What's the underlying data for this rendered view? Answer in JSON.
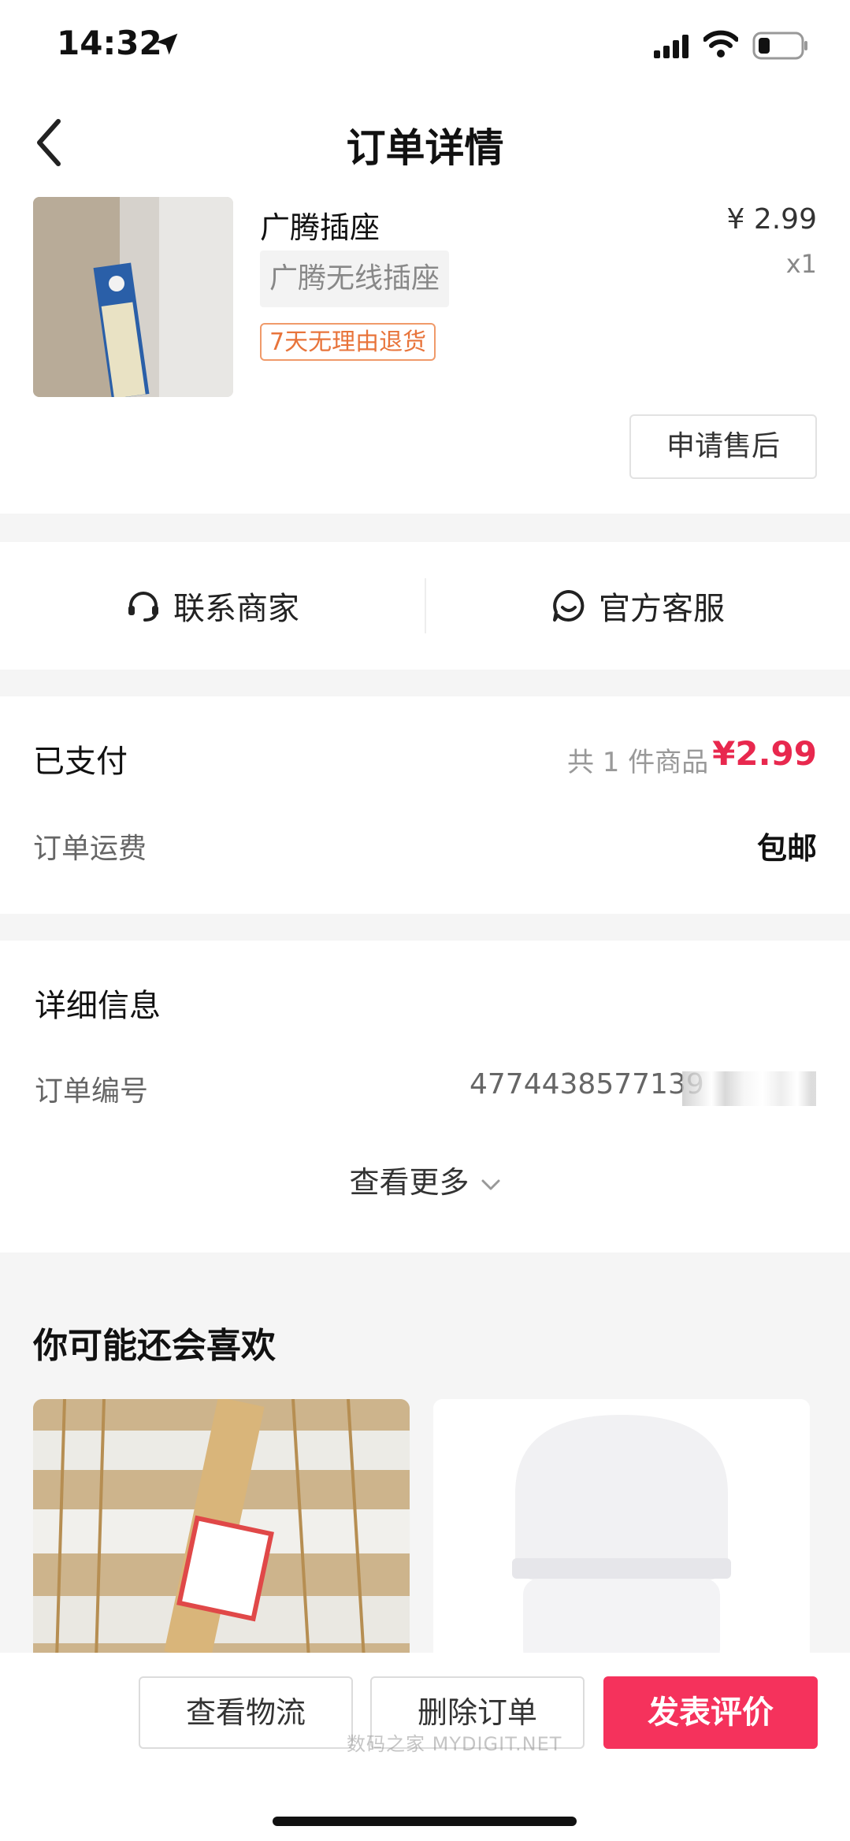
{
  "status_bar": {
    "time": "14:32"
  },
  "header": {
    "title": "订单详情"
  },
  "product": {
    "name": "广腾插座",
    "spec": "广腾无线插座",
    "tag": "7天无理由退货",
    "price": "¥ 2.99",
    "quantity": "x1",
    "aftersale_label": "申请售后"
  },
  "contact": {
    "merchant_label": "联系商家",
    "service_label": "官方客服"
  },
  "payment": {
    "status": "已支付",
    "count_text": "共 1 件商品",
    "total": "¥2.99",
    "shipping_label": "订单运费",
    "shipping_value": "包邮"
  },
  "details": {
    "title": "详细信息",
    "order_no_label": "订单编号",
    "order_no_value": "4774438577139",
    "see_more": "查看更多"
  },
  "recommend": {
    "title": "你可能还会喜欢"
  },
  "footer": {
    "logistics_label": "查看物流",
    "delete_label": "删除订单",
    "review_label": "发表评价",
    "watermark": "数码之家 MYDIGIT.NET"
  },
  "colors": {
    "accent": "#f5325c",
    "price_red": "#e8284e",
    "tag_orange": "#e8743b"
  }
}
